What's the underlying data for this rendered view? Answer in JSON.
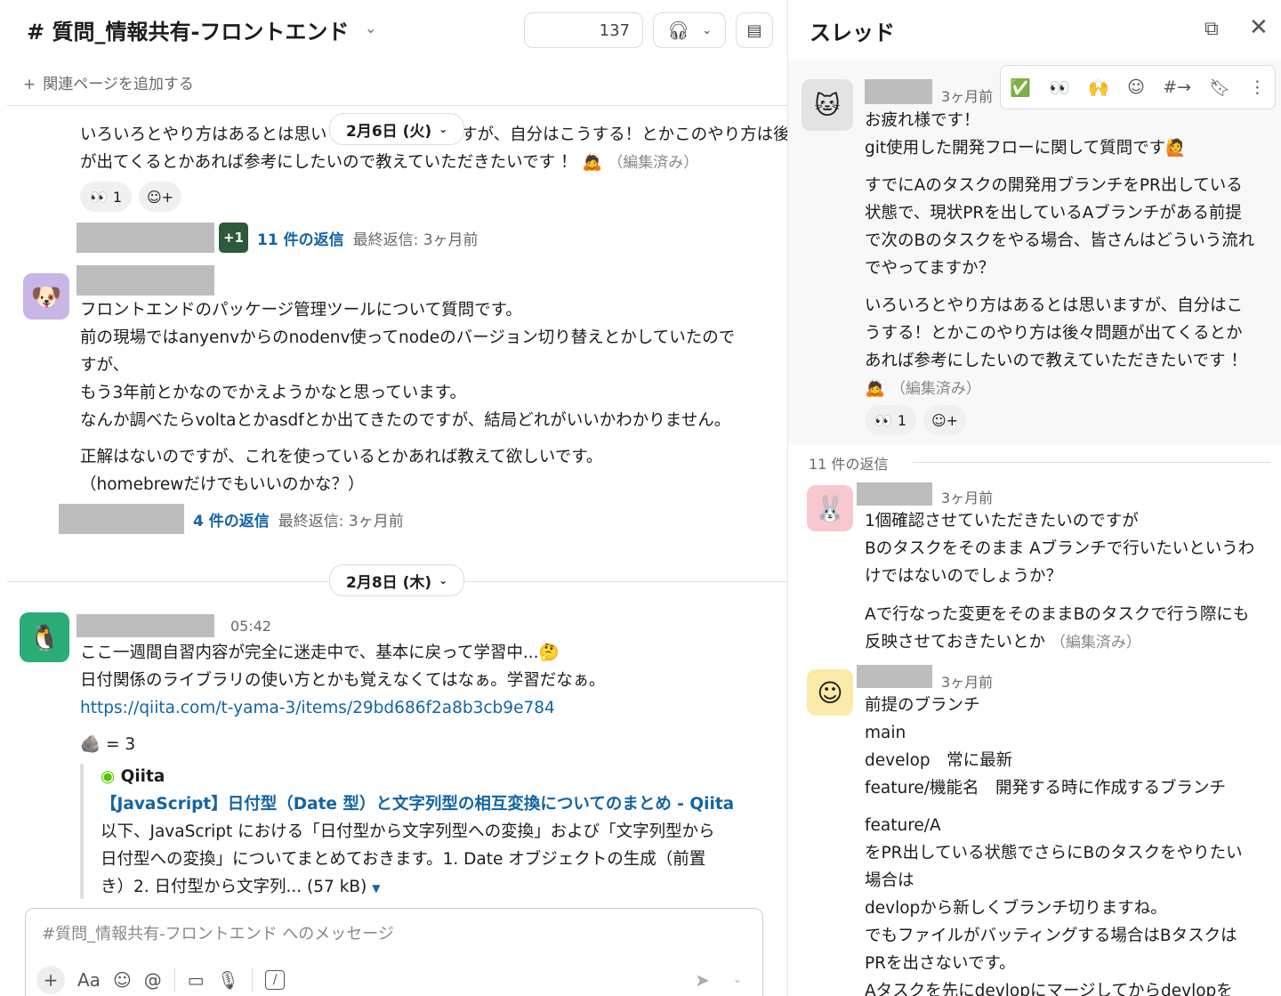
{
  "channel": {
    "title": "# 質問_情報共有-フロントエンド",
    "member_count": "137",
    "add_page": "関連ページを追加する"
  },
  "messages": [
    {
      "lines": [
        "いろいろとやり方はあるとは思い",
        "ますが、自分はこうする！とかこのやり方は後々問題",
        "が出てくるとかあれば参考にしたいので教えていただきたいです ！"
      ],
      "edited": "（編集済み）",
      "reaction_count": "1",
      "replies": "11 件の返信",
      "last_reply": "最終返信: 3ヶ月前",
      "reply_badge": "+1"
    },
    {
      "lines": [
        "フロントエンドのパッケージ管理ツールについて質問です。",
        "前の現場ではanyenvからのnodenv使ってnodeのバージョン切り替えとかしていたので",
        "すが、",
        "もう3年前とかなのでかえようかなと思っています。",
        "なんか調べたらvoltaとかasdfとか出てきたのですが、結局どれがいいかわかりません。",
        "正解はないのですが、これを使っているとかあれば教えて欲しいです。",
        "（homebrewだけでもいいのかな？）"
      ],
      "replies": "4 件の返信",
      "last_reply": "最終返信: 3ヶ月前"
    },
    {
      "time": "05:42",
      "lines": [
        "ここ一週間自習内容が完全に迷走中で、基本に戻って学習中...",
        "日付関係のライブラリの使い方とかも覚えなくてはなぁ。学習だなぁ。"
      ],
      "link": "https://qiita.com/t-yama-3/items/29bd686f2a8b3cb9e784",
      "rock_reaction": "= 3",
      "unfurl": {
        "site": "Qiita",
        "title": "【JavaScript】日付型（Date 型）と文字列型の相互変換についてのまとめ - Qiita",
        "desc": [
          "以下、JavaScript における「日付型から文字列型への変換」および「文字列型から",
          "日付型への変換」についてまとめておきます。1. Date オブジェクトの生成（前置",
          "き）2. 日付型から文字列... (57 kB)"
        ]
      }
    }
  ],
  "dates": [
    "2月6日 (火)",
    "2月8日 (木)"
  ],
  "composer": {
    "placeholder": "#質問_情報共有-フロントエンド へのメッセージ",
    "format_label": "Aa"
  },
  "thread": {
    "title": "スレッド",
    "parent": {
      "time": "3ヶ月前",
      "lines": [
        "お疲れ様です！",
        "git使用した開発フローに関して質問です",
        "すでにAのタスクの開発用ブランチをPR出している",
        "状態で、現状PRを出しているAブランチがある前提",
        "で次のBのタスクをやる場合、皆さんはどういう流れ",
        "でやってますか？",
        "いろいろとやり方はあるとは思いますが、自分はこ",
        "うする！とかこのやり方は後々問題が出てくるとか",
        "あれば参考にしたいので教えていただきたいです ！"
      ],
      "edited": "（編集済み）",
      "reaction_count": "1"
    },
    "reply_count": "11 件の返信",
    "replies": [
      {
        "time": "3ヶ月前",
        "lines": [
          "1個確認させていただきたいのですが",
          "Bのタスクをそのまま Aブランチで行いたいというわ",
          "けではないのでしょうか？",
          "Aで行なった変更をそのままBのタスクで行う際にも",
          "反映させておきたいとか"
        ],
        "edited": "（編集済み）"
      },
      {
        "time": "3ヶ月前",
        "lines": [
          "前提のブランチ",
          "main",
          "develop　常に最新",
          "feature/機能名　開発する時に作成するブランチ",
          "feature/A",
          "をPR出している状態でさらにBのタスクをやりたい",
          "場合は",
          "devlopから新しくブランチ切りますね。",
          "でもファイルがバッティングする場合はBタスクは",
          "PRを出さないです。",
          "Aタスクを先にdevlopにマージしてからdevlopを"
        ]
      }
    ]
  },
  "colors": {
    "link": "#1264a3",
    "accent_green": "#2bac76"
  }
}
